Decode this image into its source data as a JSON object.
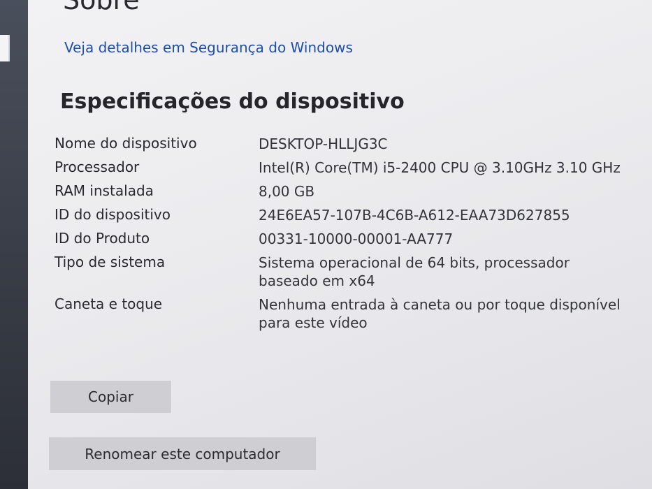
{
  "page": {
    "title": "Sobre",
    "security_link": "Veja detalhes em Segurança do Windows"
  },
  "specs": {
    "title": "Especificações do dispositivo",
    "rows": [
      {
        "label": "Nome do dispositivo",
        "value": "DESKTOP-HLLJG3C"
      },
      {
        "label": "Processador",
        "value": "Intel(R) Core(TM) i5-2400 CPU @ 3.10GHz   3.10 GHz"
      },
      {
        "label": "RAM instalada",
        "value": "8,00 GB"
      },
      {
        "label": "ID do dispositivo",
        "value": "24E6EA57-107B-4C6B-A612-EAA73D627855"
      },
      {
        "label": "ID do Produto",
        "value": "00331-10000-00001-AA777"
      },
      {
        "label": "Tipo de sistema",
        "value": "Sistema operacional de 64 bits, processador baseado em x64"
      },
      {
        "label": "Caneta e toque",
        "value": "Nenhuma entrada à caneta ou por toque disponível para este vídeo"
      }
    ]
  },
  "buttons": {
    "copy_label": "Copiar",
    "rename_label": "Renomear este computador"
  },
  "colors": {
    "link": "#1f4ea8",
    "button_bg": "#cfcfd3"
  }
}
